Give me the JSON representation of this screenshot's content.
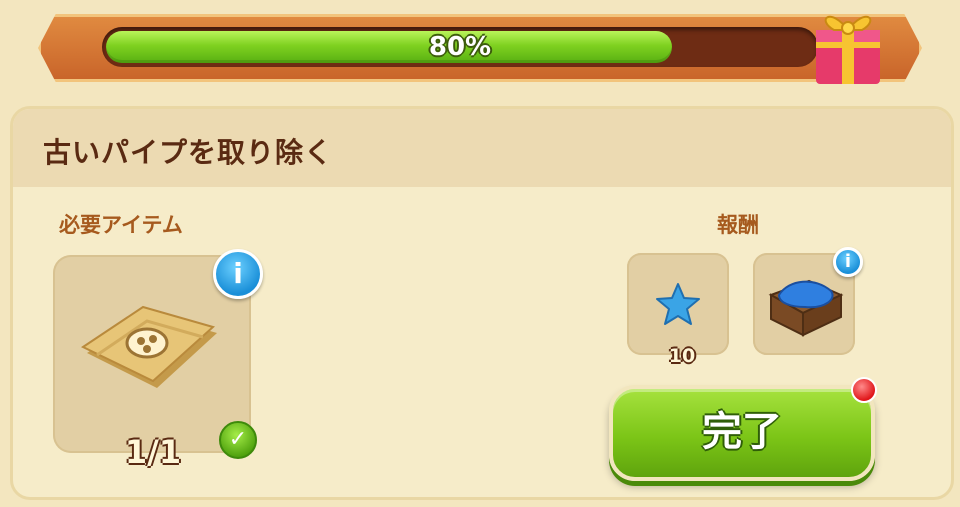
{
  "progress": {
    "text": "80%",
    "fraction": 0.8
  },
  "quest": {
    "title": "古いパイプを取り除く"
  },
  "required": {
    "label": "必要アイテム",
    "count": "1/1",
    "icon": "map-scroll-icon",
    "complete": true
  },
  "rewards": {
    "label": "報酬",
    "items": [
      {
        "icon": "blue-star-icon",
        "quantity": "10"
      },
      {
        "icon": "crate-blue-cloth-icon",
        "quantity": ""
      }
    ]
  },
  "actions": {
    "complete_label": "完了"
  },
  "colors": {
    "progress_green": "#7fd120",
    "frame_orange": "#c9652a",
    "panel": "#f6ecc9",
    "title_brown": "#5a2a12",
    "button_green": "#7cc517",
    "info_blue": "#1a8fd8",
    "notification_red": "#e0161a"
  }
}
